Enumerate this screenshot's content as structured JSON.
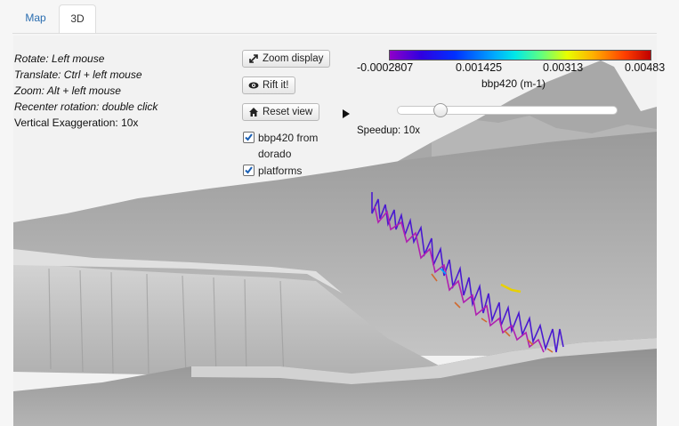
{
  "tabs": [
    {
      "label": "Map",
      "active": false
    },
    {
      "label": "3D",
      "active": true
    }
  ],
  "help": {
    "rotate": "Rotate: Left mouse",
    "translate": "Translate: Ctrl + left mouse",
    "zoom": "Zoom: Alt + left mouse",
    "recenter": "Recenter rotation: double click",
    "exaggeration": "Vertical Exaggeration: 10x"
  },
  "buttons": {
    "zoom_display": "Zoom display",
    "rift": "Rift it!",
    "reset_view": "Reset view"
  },
  "layers": [
    {
      "label_line1": "bbp420 from",
      "label_line2": "dorado",
      "checked": true
    },
    {
      "label_line1": "platforms",
      "checked": true
    }
  ],
  "colorbar": {
    "ticks": [
      "-0.0002807",
      "0.001425",
      "0.00313",
      "0.00483"
    ],
    "label": "bbp420 (m-1)",
    "colors": [
      "#8f00c8",
      "#0030ff",
      "#00e8e8",
      "#e8ff00",
      "#ff4000",
      "#c00000"
    ]
  },
  "animation": {
    "speedup": "Speedup: 10x",
    "position": 0.2
  },
  "icons": [
    "resize-arrows-icon",
    "eye-icon",
    "home-icon",
    "play-icon",
    "checkmark-icon"
  ]
}
